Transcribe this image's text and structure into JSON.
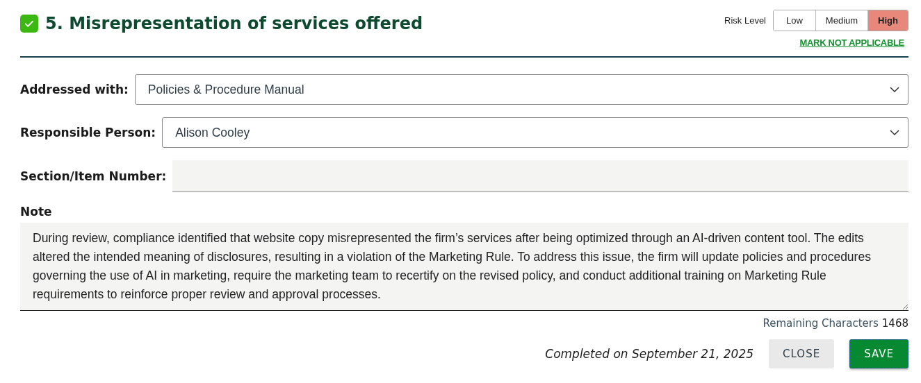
{
  "header": {
    "checked": true,
    "title": "5. Misrepresentation of services offered"
  },
  "risk_level": {
    "label": "Risk Level",
    "options": [
      {
        "label": "Low",
        "selected": false
      },
      {
        "label": "Medium",
        "selected": false
      },
      {
        "label": "High",
        "selected": true
      }
    ],
    "link": "MARK NOT APPLICABLE"
  },
  "fields": [
    {
      "kind": "select",
      "label": "Addressed with:",
      "value": "Policies & Procedure Manual"
    },
    {
      "kind": "select",
      "label": "Responsible Person:",
      "value": "Alison Cooley"
    },
    {
      "kind": "text",
      "label": "Section/Item Number:"
    }
  ],
  "note": {
    "label": "Note",
    "value": "During review, compliance identified that website copy misrepresented the firm’s services after being optimized through an AI-driven content tool. The edits altered the intended meaning of disclosures, resulting in a violation of the Marketing Rule. To address this issue, the firm will update policies and procedures governing the use of AI in marketing, require the marketing team to recertify on the revised policy, and conduct additional training on Marketing Rule requirements to reinforce proper review and approval processes.",
    "remaining_label": "Remaining Characters",
    "remaining": "1468"
  },
  "footer": {
    "completed": "Completed on September 21, 2025",
    "buttons": [
      {
        "kind": "secondary",
        "label": "CLOSE"
      },
      {
        "kind": "primary",
        "label": "SAVE"
      }
    ]
  }
}
